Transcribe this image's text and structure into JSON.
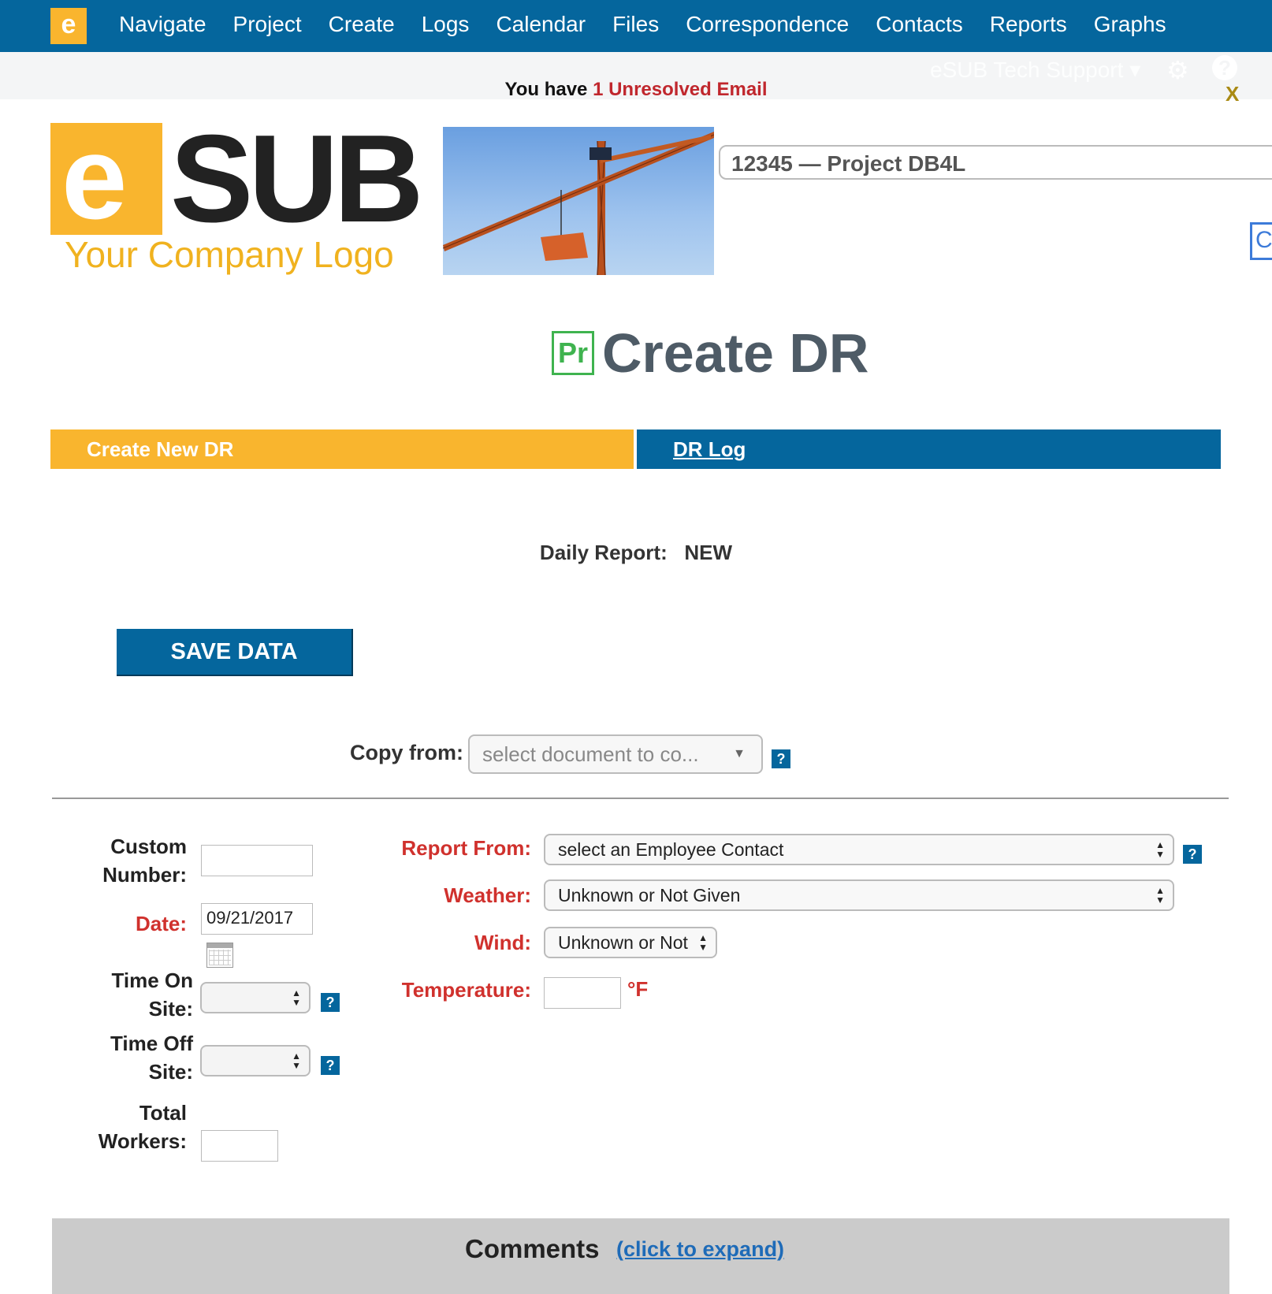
{
  "nav": {
    "items": [
      "Navigate",
      "Project",
      "Create",
      "Logs",
      "Calendar",
      "Files",
      "Correspondence",
      "Contacts",
      "Reports",
      "Graphs"
    ]
  },
  "subbar": {
    "user": "eSUB Tech Support"
  },
  "alert": {
    "prefix": "You have",
    "highlight": "1 Unresolved Email",
    "close": "X"
  },
  "logo": {
    "letter": "e",
    "brand": "SUB",
    "tagline": "Your Company Logo"
  },
  "project_selector": {
    "value": "12345 — Project DB4L"
  },
  "edge_box_text": "C",
  "page": {
    "icon_text": "Pr",
    "title": "Create DR"
  },
  "tabs": {
    "create": "Create New DR",
    "log": "DR Log"
  },
  "daily_report": {
    "label": "Daily Report:",
    "value": "NEW"
  },
  "save_button": "SAVE DATA",
  "copy_from": {
    "label": "Copy from:",
    "placeholder": "select document to co..."
  },
  "help_glyph": "?",
  "form": {
    "custom_number": {
      "label1": "Custom",
      "label2": "Number:",
      "value": ""
    },
    "date": {
      "label": "Date:",
      "value": "09/21/2017"
    },
    "time_on": {
      "label1": "Time On",
      "label2": "Site:"
    },
    "time_off": {
      "label1": "Time Off",
      "label2": "Site:"
    },
    "total_workers": {
      "label1": "Total",
      "label2": "Workers:",
      "value": ""
    },
    "report_from": {
      "label": "Report From:",
      "value": "select an Employee Contact"
    },
    "weather": {
      "label": "Weather:",
      "value": "Unknown or Not Given"
    },
    "wind": {
      "label": "Wind:",
      "value": "Unknown or Not"
    },
    "temperature": {
      "label": "Temperature:",
      "value": "",
      "unit": "°F"
    }
  },
  "comments": {
    "title": "Comments",
    "link": "(click to expand)"
  },
  "colors": {
    "nav_blue": "#05669d",
    "accent_orange": "#f9b52e",
    "required_red": "#d0312d"
  }
}
